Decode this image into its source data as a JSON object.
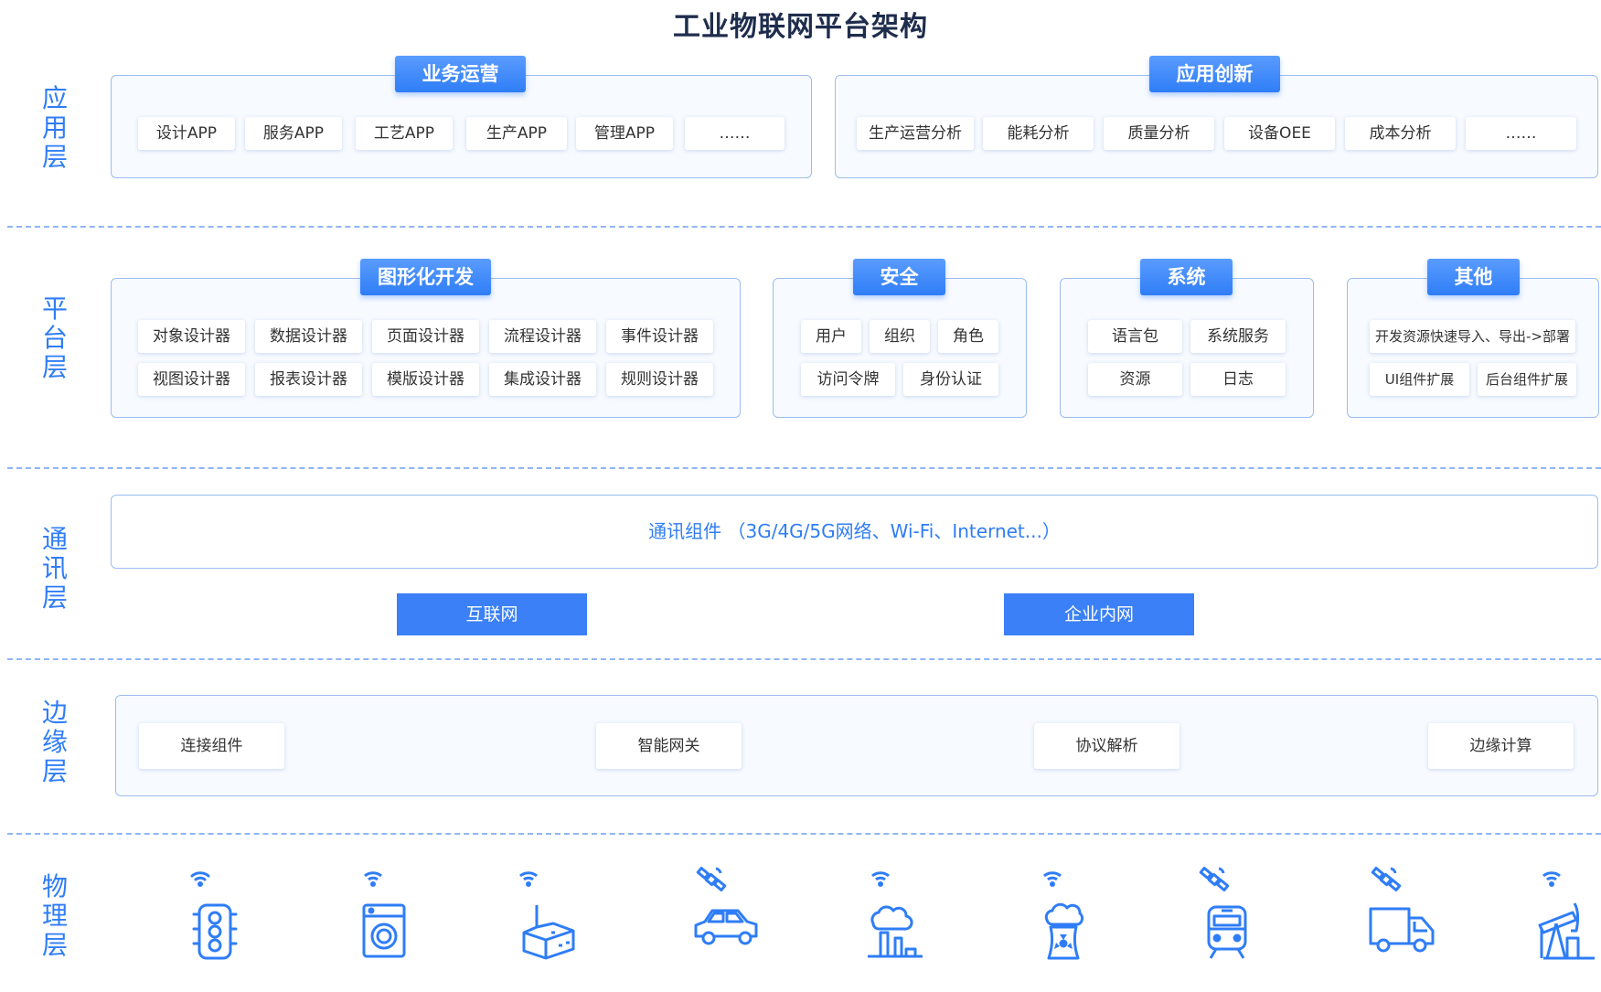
{
  "title": "工业物联网平台架构",
  "layers": {
    "app": [
      "应",
      "用",
      "层"
    ],
    "platform": [
      "平",
      "台",
      "层"
    ],
    "comm": [
      "通",
      "讯",
      "层"
    ],
    "edge": [
      "边",
      "缘",
      "层"
    ],
    "physical": [
      "物",
      "理",
      "层"
    ]
  },
  "app_layer": {
    "ops": {
      "header": "业务运营",
      "items": [
        "设计APP",
        "服务APP",
        "工艺APP",
        "生产APP",
        "管理APP",
        "……"
      ]
    },
    "innov": {
      "header": "应用创新",
      "items": [
        "生产运营分析",
        "能耗分析",
        "质量分析",
        "设备OEE",
        "成本分析",
        "……"
      ]
    }
  },
  "platform_layer": {
    "dev": {
      "header": "图形化开发",
      "items": [
        "对象设计器",
        "数据设计器",
        "页面设计器",
        "流程设计器",
        "事件设计器",
        "视图设计器",
        "报表设计器",
        "模版设计器",
        "集成设计器",
        "规则设计器"
      ]
    },
    "security": {
      "header": "安全",
      "items": [
        "用户",
        "组织",
        "角色",
        "访问令牌",
        "身份认证"
      ]
    },
    "system": {
      "header": "系统",
      "items": [
        "语言包",
        "系统服务",
        "资源",
        "日志"
      ]
    },
    "other": {
      "header": "其他",
      "items": [
        "开发资源快速导入、导出->部署",
        "UI组件扩展",
        "后台组件扩展"
      ]
    }
  },
  "comm_layer": {
    "component": "通讯组件 （3G/4G/5G网络、Wi-Fi、Internet...）",
    "networks": [
      "互联网",
      "企业内网"
    ]
  },
  "edge_layer": {
    "items": [
      "连接组件",
      "智能网关",
      "协议解析",
      "边缘计算"
    ]
  },
  "physical_layer": {
    "icons": [
      {
        "name": "traffic-light-icon",
        "signal": "wifi"
      },
      {
        "name": "washing-machine-icon",
        "signal": "wifi"
      },
      {
        "name": "factory-icon",
        "signal": "wifi"
      },
      {
        "name": "car-icon",
        "signal": "satellite"
      },
      {
        "name": "industrial-plant-icon",
        "signal": "wifi"
      },
      {
        "name": "nuclear-plant-icon",
        "signal": "wifi"
      },
      {
        "name": "train-icon",
        "signal": "satellite"
      },
      {
        "name": "truck-icon",
        "signal": "satellite"
      },
      {
        "name": "oil-pump-icon",
        "signal": "wifi"
      }
    ],
    "icon_color": "#2f7df6"
  },
  "colors": {
    "accent": "#2f7df6",
    "border": "#9bbdf0",
    "title": "#1f2d4d"
  }
}
